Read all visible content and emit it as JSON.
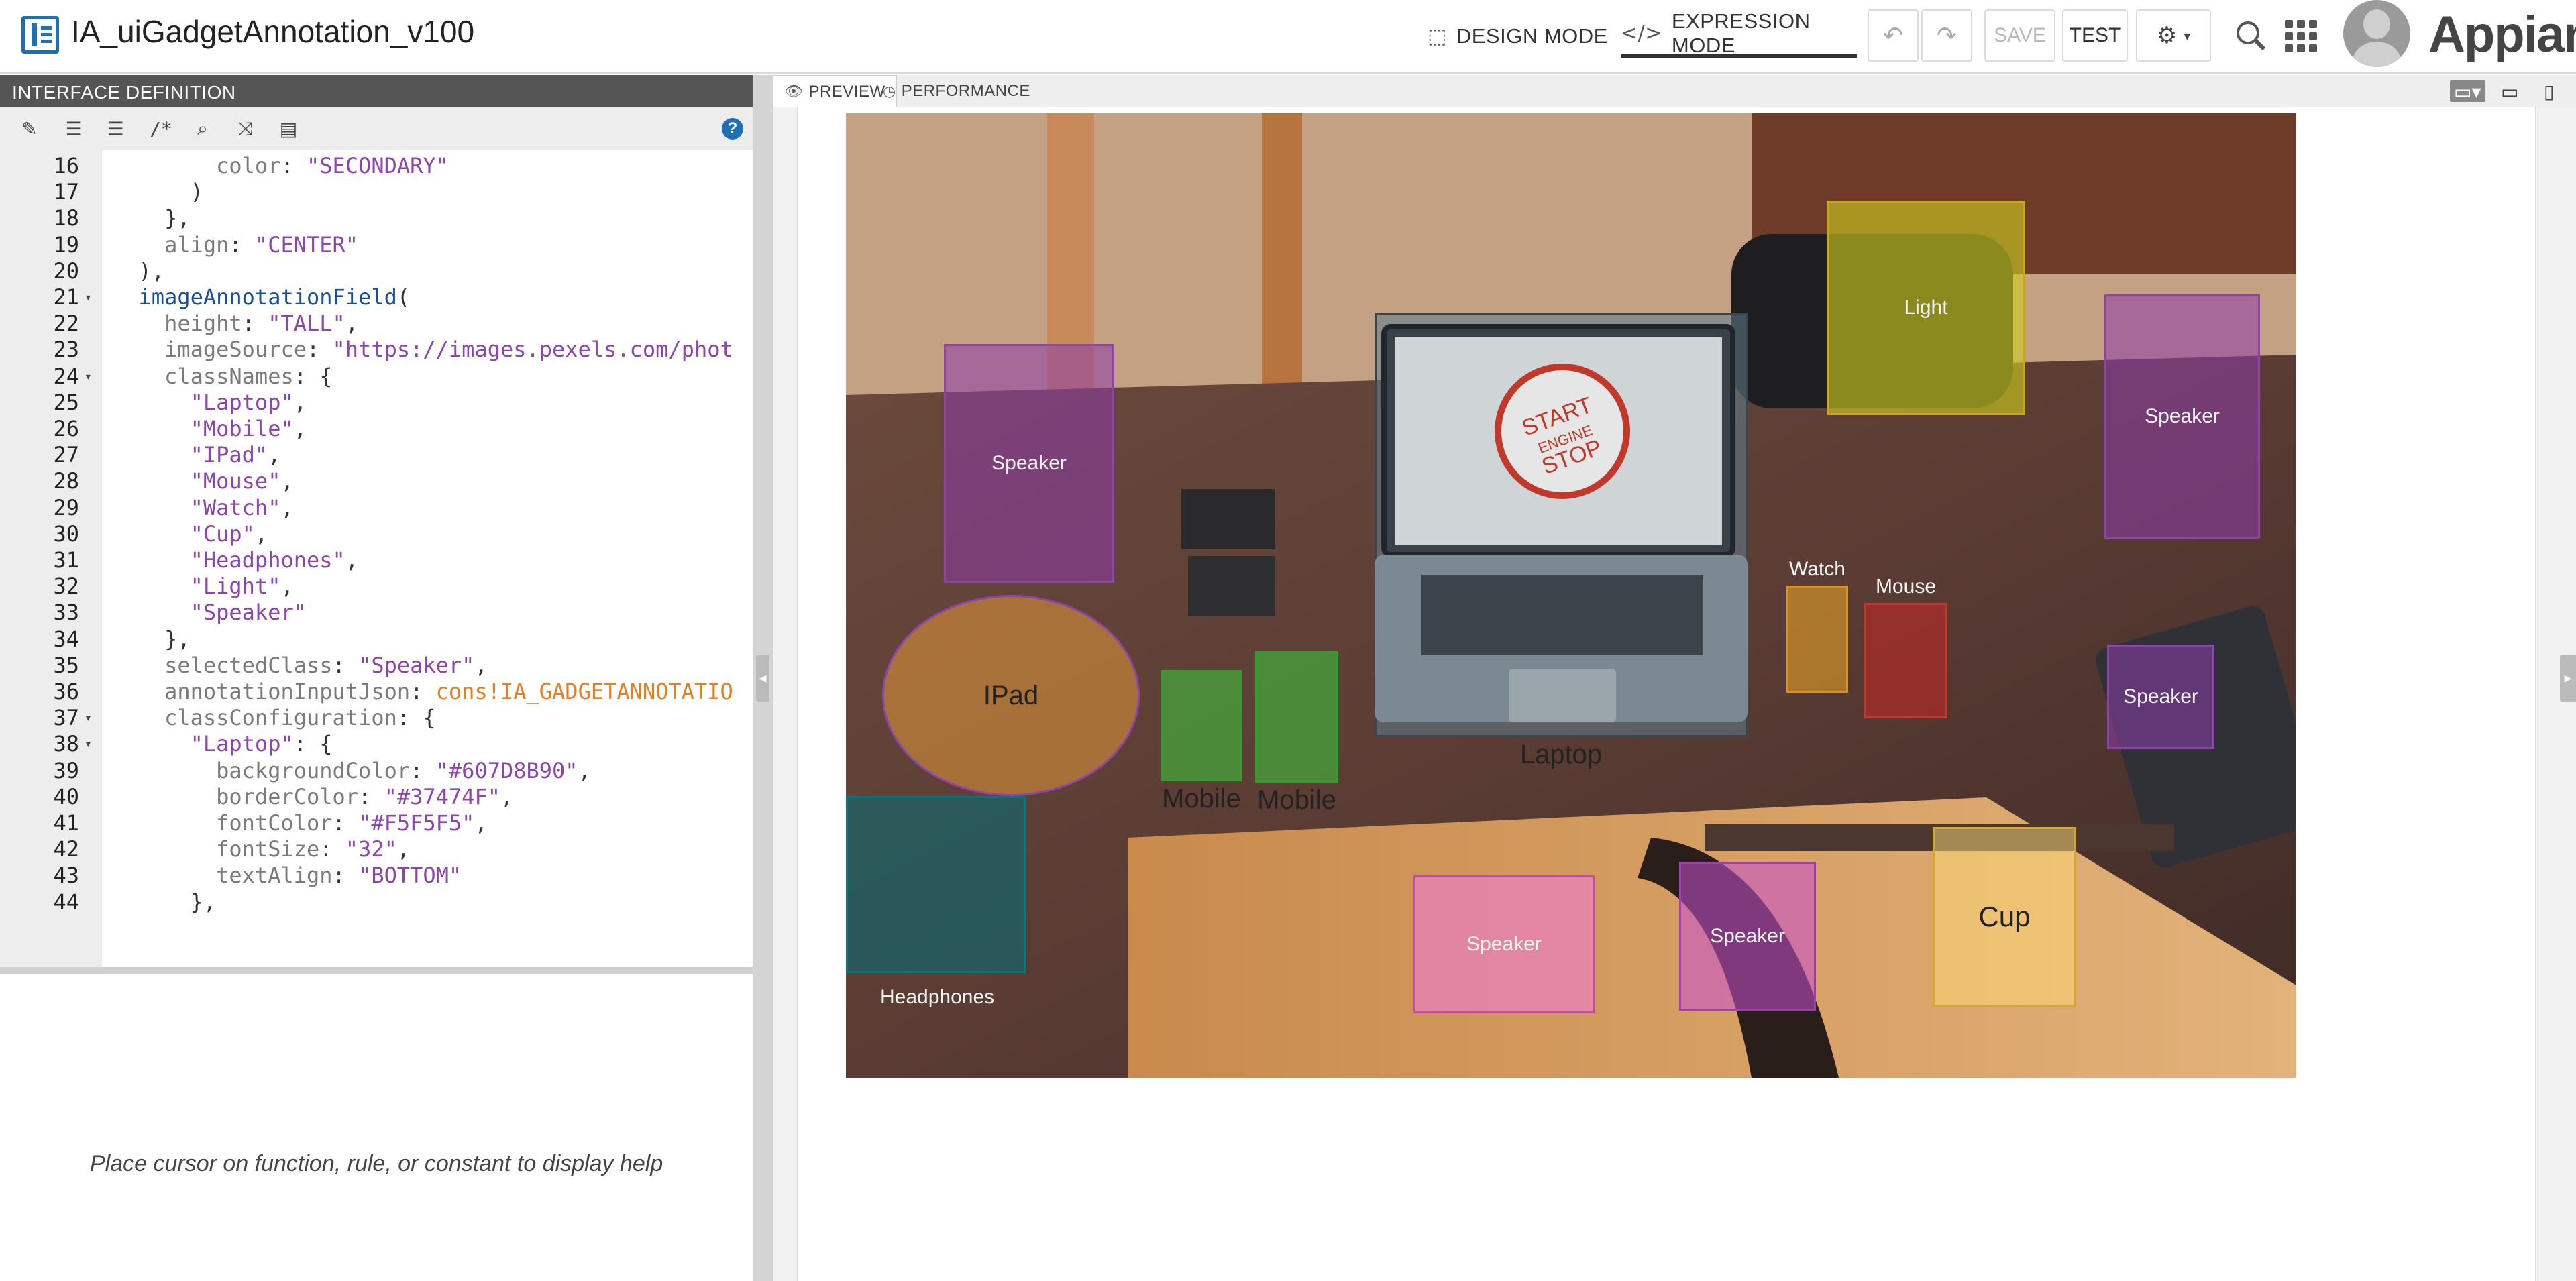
{
  "header": {
    "title": "IA_uiGadgetAnnotation_v100",
    "design_mode": "DESIGN MODE",
    "expression_mode": "EXPRESSION MODE",
    "save": "SAVE",
    "test": "TEST",
    "brand": "Appian"
  },
  "left": {
    "panel_title": "INTERFACE DEFINITION",
    "help_text": "Place cursor on function, rule, or constant to display help",
    "toolbar_icons": [
      "format-icon",
      "indent-icon",
      "outdent-icon",
      "comment-icon",
      "search-icon",
      "shuffle-icon",
      "database-icon",
      "help-icon"
    ],
    "code_lines": [
      {
        "n": "16",
        "fold": "",
        "parts": [
          [
            "p",
            "        "
          ],
          [
            "k",
            "color"
          ],
          [
            "p",
            ": "
          ],
          [
            "s",
            "\"SECONDARY\""
          ]
        ]
      },
      {
        "n": "17",
        "fold": "",
        "parts": [
          [
            "p",
            "      )"
          ]
        ]
      },
      {
        "n": "18",
        "fold": "",
        "parts": [
          [
            "p",
            "    },"
          ]
        ]
      },
      {
        "n": "19",
        "fold": "",
        "parts": [
          [
            "p",
            "    "
          ],
          [
            "k",
            "align"
          ],
          [
            "p",
            ": "
          ],
          [
            "s",
            "\"CENTER\""
          ]
        ]
      },
      {
        "n": "20",
        "fold": "",
        "parts": [
          [
            "p",
            "  ),"
          ]
        ]
      },
      {
        "n": "21",
        "fold": "▾",
        "parts": [
          [
            "p",
            "  "
          ],
          [
            "f",
            "imageAnnotationField"
          ],
          [
            "p",
            "("
          ]
        ]
      },
      {
        "n": "22",
        "fold": "",
        "parts": [
          [
            "p",
            "    "
          ],
          [
            "k",
            "height"
          ],
          [
            "p",
            ": "
          ],
          [
            "s",
            "\"TALL\""
          ],
          [
            "p",
            ","
          ]
        ]
      },
      {
        "n": "23",
        "fold": "",
        "parts": [
          [
            "p",
            "    "
          ],
          [
            "k",
            "imageSource"
          ],
          [
            "p",
            ": "
          ],
          [
            "s",
            "\"https://images.pexels.com/phot"
          ]
        ]
      },
      {
        "n": "24",
        "fold": "▾",
        "parts": [
          [
            "p",
            "    "
          ],
          [
            "k",
            "classNames"
          ],
          [
            "p",
            ": {"
          ]
        ]
      },
      {
        "n": "25",
        "fold": "",
        "parts": [
          [
            "p",
            "      "
          ],
          [
            "s",
            "\"Laptop\""
          ],
          [
            "p",
            ","
          ]
        ]
      },
      {
        "n": "26",
        "fold": "",
        "parts": [
          [
            "p",
            "      "
          ],
          [
            "s",
            "\"Mobile\""
          ],
          [
            "p",
            ","
          ]
        ]
      },
      {
        "n": "27",
        "fold": "",
        "parts": [
          [
            "p",
            "      "
          ],
          [
            "s",
            "\"IPad\""
          ],
          [
            "p",
            ","
          ]
        ]
      },
      {
        "n": "28",
        "fold": "",
        "parts": [
          [
            "p",
            "      "
          ],
          [
            "s",
            "\"Mouse\""
          ],
          [
            "p",
            ","
          ]
        ]
      },
      {
        "n": "29",
        "fold": "",
        "parts": [
          [
            "p",
            "      "
          ],
          [
            "s",
            "\"Watch\""
          ],
          [
            "p",
            ","
          ]
        ]
      },
      {
        "n": "30",
        "fold": "",
        "parts": [
          [
            "p",
            "      "
          ],
          [
            "s",
            "\"Cup\""
          ],
          [
            "p",
            ","
          ]
        ]
      },
      {
        "n": "31",
        "fold": "",
        "parts": [
          [
            "p",
            "      "
          ],
          [
            "s",
            "\"Headphones\""
          ],
          [
            "p",
            ","
          ]
        ]
      },
      {
        "n": "32",
        "fold": "",
        "parts": [
          [
            "p",
            "      "
          ],
          [
            "s",
            "\"Light\""
          ],
          [
            "p",
            ","
          ]
        ]
      },
      {
        "n": "33",
        "fold": "",
        "parts": [
          [
            "p",
            "      "
          ],
          [
            "s",
            "\"Speaker\""
          ]
        ]
      },
      {
        "n": "34",
        "fold": "",
        "parts": [
          [
            "p",
            "    },"
          ]
        ]
      },
      {
        "n": "35",
        "fold": "",
        "parts": [
          [
            "p",
            "    "
          ],
          [
            "k",
            "selectedClass"
          ],
          [
            "p",
            ": "
          ],
          [
            "s",
            "\"Speaker\""
          ],
          [
            "p",
            ","
          ]
        ]
      },
      {
        "n": "36",
        "fold": "",
        "parts": [
          [
            "p",
            "    "
          ],
          [
            "k",
            "annotationInputJson"
          ],
          [
            "p",
            ": "
          ],
          [
            "c",
            "cons!IA_GADGETANNOTATIO"
          ]
        ]
      },
      {
        "n": "37",
        "fold": "▾",
        "parts": [
          [
            "p",
            "    "
          ],
          [
            "k",
            "classConfiguration"
          ],
          [
            "p",
            ": {"
          ]
        ]
      },
      {
        "n": "38",
        "fold": "▾",
        "parts": [
          [
            "p",
            "      "
          ],
          [
            "s",
            "\"Laptop\""
          ],
          [
            "p",
            ": {"
          ]
        ]
      },
      {
        "n": "39",
        "fold": "",
        "parts": [
          [
            "p",
            "        "
          ],
          [
            "k",
            "backgroundColor"
          ],
          [
            "p",
            ": "
          ],
          [
            "s",
            "\"#607D8B90\""
          ],
          [
            "p",
            ","
          ]
        ]
      },
      {
        "n": "40",
        "fold": "",
        "parts": [
          [
            "p",
            "        "
          ],
          [
            "k",
            "borderColor"
          ],
          [
            "p",
            ": "
          ],
          [
            "s",
            "\"#37474F\""
          ],
          [
            "p",
            ","
          ]
        ]
      },
      {
        "n": "41",
        "fold": "",
        "parts": [
          [
            "p",
            "        "
          ],
          [
            "k",
            "fontColor"
          ],
          [
            "p",
            ": "
          ],
          [
            "s",
            "\"#F5F5F5\""
          ],
          [
            "p",
            ","
          ]
        ]
      },
      {
        "n": "42",
        "fold": "",
        "parts": [
          [
            "p",
            "        "
          ],
          [
            "k",
            "fontSize"
          ],
          [
            "p",
            ": "
          ],
          [
            "s",
            "\"32\""
          ],
          [
            "p",
            ","
          ]
        ]
      },
      {
        "n": "43",
        "fold": "",
        "parts": [
          [
            "p",
            "        "
          ],
          [
            "k",
            "textAlign"
          ],
          [
            "p",
            ": "
          ],
          [
            "s",
            "\"BOTTOM\""
          ]
        ]
      },
      {
        "n": "44",
        "fold": "",
        "parts": [
          [
            "p",
            "      },"
          ]
        ]
      }
    ]
  },
  "right": {
    "tab_preview": "PREVIEW",
    "tab_performance": "PERFORMANCE"
  },
  "annotations": [
    {
      "label": "Speaker",
      "bg": "rgba(140,60,170,0.55)",
      "border": "#8e44ad",
      "style": ""
    },
    {
      "label": "Light",
      "bg": "rgba(205,205,30,0.62)",
      "border": "#c9a227",
      "style": ""
    },
    {
      "label": "Speaker",
      "bg": "rgba(140,60,170,0.55)",
      "border": "#8e44ad",
      "style": ""
    },
    {
      "label": "Laptop",
      "bg": "rgba(96,125,139,0.56)",
      "border": "#37474F",
      "style": "bottom"
    },
    {
      "label": "IPad",
      "bg": "rgba(255,170,60,0.45)",
      "border": "#8e44ad",
      "style": "ellipse"
    },
    {
      "label": "Mobile",
      "bg": "rgba(60,200,60,0.55)",
      "border": "#2e9e2e",
      "style": "bottom"
    },
    {
      "label": "Mobile",
      "bg": "rgba(60,200,60,0.55)",
      "border": "#2e9e2e",
      "style": "bottom"
    },
    {
      "label": "Watch",
      "bg": "rgba(240,170,40,0.55)",
      "border": "#e09020",
      "style": "top"
    },
    {
      "label": "Mouse",
      "bg": "rgba(200,40,40,0.55)",
      "border": "#c0392b",
      "style": "top"
    },
    {
      "label": "Speaker",
      "bg": "rgba(140,60,170,0.55)",
      "border": "#8e44ad",
      "style": ""
    },
    {
      "label": "Headphones",
      "bg": "rgba(0,110,120,0.55)",
      "border": "#007a80",
      "style": "below"
    },
    {
      "label": "Speaker",
      "bg": "rgba(240,120,220,0.55)",
      "border": "#c04ab0",
      "style": ""
    },
    {
      "label": "Speaker",
      "bg": "rgba(200,80,210,0.55)",
      "border": "#a040b0",
      "style": ""
    },
    {
      "label": "Cup",
      "bg": "rgba(255,220,120,0.5)",
      "border": "#d4a830",
      "style": "dark"
    }
  ]
}
